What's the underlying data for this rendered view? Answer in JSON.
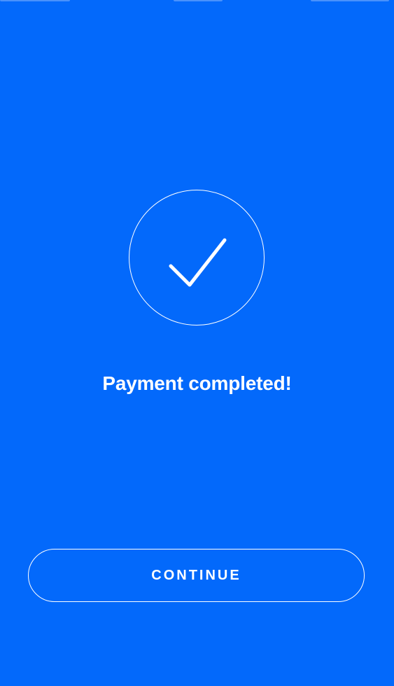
{
  "payment_success": {
    "icon": "checkmark-icon",
    "message": "Payment completed!",
    "continue_label": "CONTINUE"
  },
  "colors": {
    "background": "#0369FB",
    "foreground": "#FFFFFF"
  }
}
